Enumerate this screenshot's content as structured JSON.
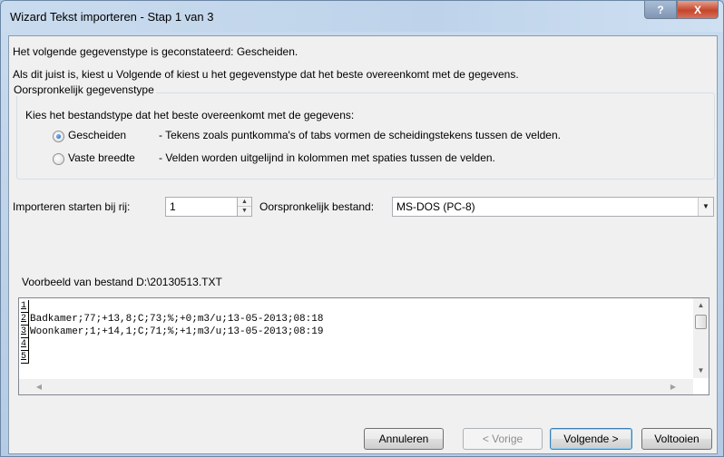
{
  "window": {
    "title": "Wizard Tekst importeren - Stap 1 van 3",
    "help_glyph": "?",
    "close_glyph": "X"
  },
  "intro": {
    "line1": "Het volgende gegevenstype is geconstateerd: Gescheiden.",
    "line2": "Als dit juist is, kiest u Volgende of kiest u het gegevenstype dat het beste overeenkomt met de gegevens."
  },
  "group": {
    "legend": "Oorspronkelijk gegevenstype",
    "prompt": "Kies het bestandstype dat het beste overeenkomt met de gegevens:",
    "options": [
      {
        "label": "Gescheiden",
        "description": "- Tekens zoals puntkomma's of tabs vormen de scheidingstekens tussen de velden.",
        "checked": true
      },
      {
        "label": "Vaste breedte",
        "description": "- Velden worden uitgelijnd in kolommen met spaties tussen de velden.",
        "checked": false
      }
    ]
  },
  "start_row": {
    "label": "Importeren starten bij rij:",
    "value": "1"
  },
  "origin": {
    "label": "Oorspronkelijk bestand:",
    "value": "MS-DOS (PC-8)"
  },
  "preview": {
    "label": "Voorbeeld van bestand D:\\20130513.TXT",
    "lines": [
      {
        "num": "1",
        "text": ""
      },
      {
        "num": "2",
        "text": "Badkamer;77;+13,8;C;73;%;+0;m3/u;13-05-2013;08:18"
      },
      {
        "num": "3",
        "text": "Woonkamer;1;+14,1;C;71;%;+1;m3/u;13-05-2013;08:19"
      },
      {
        "num": "4",
        "text": ""
      },
      {
        "num": "5",
        "text": ""
      }
    ]
  },
  "buttons": {
    "cancel": "Annuleren",
    "back": "< Vorige",
    "next": "Volgende >",
    "finish": "Voltooien"
  },
  "icons": {
    "spin_up": "▲",
    "spin_down": "▼",
    "dropdown": "▼",
    "scroll_up": "▲",
    "scroll_down": "▼",
    "scroll_left": "◀",
    "scroll_right": "▶"
  }
}
